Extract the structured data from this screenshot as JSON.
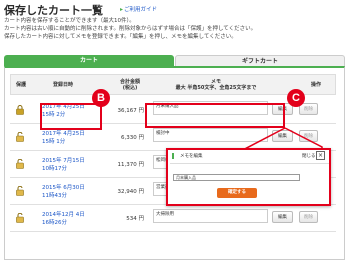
{
  "page": {
    "title": "保存したカート一覧",
    "guide_link": "ご利用ガイド",
    "intro": [
      "カート内容を保存することができます（最大10件）。",
      "カート内容は古い順に自動的に削除されます。削除対象からはずす場合は「保護」を押してください。",
      "保存したカート内容に対してメモを登録できます。「編集」を押し、メモを編集してください。"
    ]
  },
  "tabs": [
    "カート",
    "ギフトカート"
  ],
  "table": {
    "headers": {
      "lock": "保護",
      "date": "登録日時",
      "total": "合計金額\n(税込)",
      "memo": "メモ\n最大 半角50文字、全角25文字まで",
      "ops": "操作"
    },
    "rows": [
      {
        "date": "2017年 4月25日\n15時 2分",
        "total": "36,167 円",
        "memo": "月末購入品",
        "locked": true
      },
      {
        "date": "2017年 4月25日\n15時 1分",
        "total": "6,330 円",
        "memo": "検討中",
        "locked": false
      },
      {
        "date": "2015年 7月15日\n10時17分",
        "total": "11,370 円",
        "memo": "松岡様",
        "locked": false
      },
      {
        "date": "2015年 6月30日\n11時43分",
        "total": "32,940 円",
        "memo": "営業部",
        "locked": false
      },
      {
        "date": "2014年12月 4日\n16時26分",
        "total": "534 円",
        "memo": "大掃除用",
        "locked": false
      }
    ],
    "edit_label": "編集",
    "delete_label": "削除"
  },
  "badges": {
    "b": "B",
    "c": "C"
  },
  "popup": {
    "title": "メモを編集",
    "close_label": "閉じる",
    "close_glyph": "×",
    "input_value": "月末購入品",
    "submit_label": "確定する"
  },
  "colors": {
    "accent": "#4caf50",
    "callout": "#e3001b",
    "submit": "#e86a1c",
    "link": "#1a55c7"
  }
}
